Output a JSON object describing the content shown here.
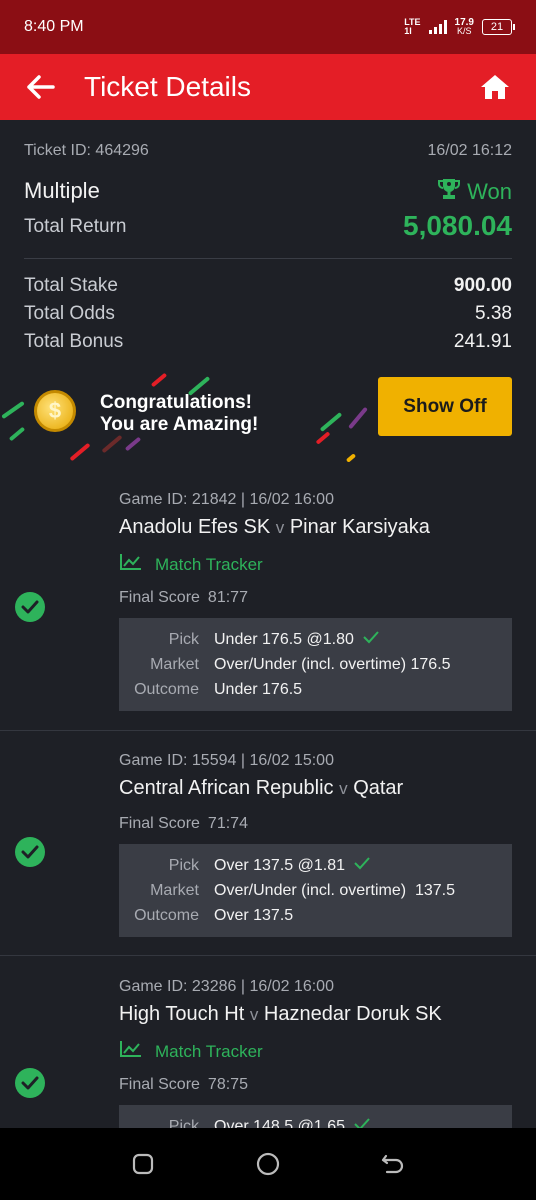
{
  "status_bar": {
    "time": "8:40 PM",
    "network": "LTE",
    "network_sub": "1l",
    "speed_value": "17.9",
    "speed_unit": "K/S",
    "battery": "21"
  },
  "header": {
    "title": "Ticket Details",
    "back_icon": "arrow-left-icon",
    "home_icon": "home-icon"
  },
  "ticket": {
    "id": "Ticket ID: 464296",
    "datetime": "16/02 16:12",
    "bet_type": "Multiple",
    "status": "Won",
    "total_return_label": "Total Return",
    "total_return": "5,080.04",
    "stats": [
      {
        "label": "Total Stake",
        "value": "900.00"
      },
      {
        "label": "Total Odds",
        "value": "5.38"
      },
      {
        "label": "Total Bonus",
        "value": "241.91"
      }
    ]
  },
  "banner": {
    "coin_symbol": "$",
    "line1": "Congratulations!",
    "line2": "You are Amazing!",
    "button": "Show Off"
  },
  "colors": {
    "brand_red": "#e41e26",
    "status_red": "#8b0e14",
    "won_green": "#2eb35b",
    "button_yellow": "#f0b100",
    "background": "#1e2026"
  },
  "games": [
    {
      "game_id": "Game ID: 21842 | 16/02 16:00",
      "home": "Anadolu Efes SK",
      "away": "Pinar Karsiyaka",
      "separator": "v",
      "tracker": "Match Tracker",
      "score_label": "Final Score",
      "score": "81:77",
      "pick_label": "Pick",
      "pick": "Under 176.5 @1.80",
      "market_label": "Market",
      "market": "Over/Under (incl. overtime) 176.5",
      "outcome_label": "Outcome",
      "outcome": "Under 176.5"
    },
    {
      "game_id": "Game ID: 15594 | 16/02 15:00",
      "home": "Central African Republic",
      "away": "Qatar",
      "separator": "v",
      "score_label": "Final Score",
      "score": "71:74",
      "pick_label": "Pick",
      "pick": "Over 137.5 @1.81",
      "market_label": "Market",
      "market": "Over/Under (incl. overtime)  137.5",
      "outcome_label": "Outcome",
      "outcome": "Over 137.5"
    },
    {
      "game_id": "Game ID: 23286 | 16/02 16:00",
      "home": "High Touch Ht",
      "away": "Haznedar Doruk SK",
      "separator": "v",
      "tracker": "Match Tracker",
      "score_label": "Final Score",
      "score": "78:75",
      "pick_label": "Pick",
      "pick": "Over 148.5 @1.65"
    }
  ]
}
